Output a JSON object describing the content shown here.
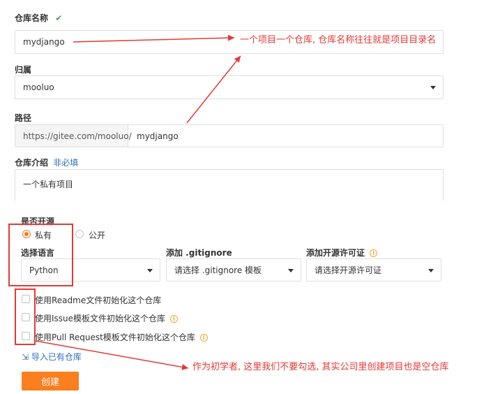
{
  "form": {
    "repo_name_label": "仓库名称",
    "repo_name_value": "mydjango",
    "owner_label": "归属",
    "owner_value": "mooluo",
    "path_label": "路径",
    "path_prefix": "https://gitee.com/mooluo/",
    "path_value": "mydjango",
    "intro_label": "仓库介绍",
    "intro_optional": "非必填",
    "intro_value": "一个私有项目",
    "open_source_label": "是否开源",
    "private_label": "私有",
    "public_label": "公开",
    "language_label": "选择语言",
    "language_value": "Python",
    "gitignore_label": "添加 .gitignore",
    "gitignore_placeholder": "请选择 .gitignore 模板",
    "license_label": "添加开源许可证",
    "license_placeholder": "请选择开源许可证",
    "checkbox_readme": "使用Readme文件初始化这个仓库",
    "checkbox_issue": "使用Issue模板文件初始化这个仓库",
    "checkbox_pr": "使用Pull Request模板文件初始化这个仓库",
    "import_link": "导入已有仓库",
    "create_button": "创建"
  },
  "annotations": {
    "top_note": "一个项目一个仓库, 仓库名称往往就是项目目录名",
    "bottom_note": "作为初学者, 这里我们不要勾选, 其实公司里创建项目也是空仓库"
  },
  "colors": {
    "accent": "#fa7f1e",
    "annotation_red": "#e53935",
    "check_green": "#3aa757",
    "link_blue": "#2a6fbd"
  },
  "state": {
    "visibility_selected": "私有"
  }
}
